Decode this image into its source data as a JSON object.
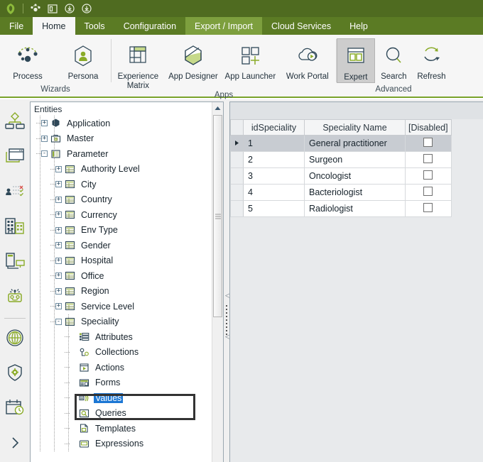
{
  "titlebar": {
    "icons": [
      {
        "name": "app-logo-icon",
        "label": "Bizagi"
      },
      {
        "name": "process-quick-icon",
        "label": "Process"
      },
      {
        "name": "layout-quick-icon",
        "label": "Layout"
      },
      {
        "name": "download-quick-icon",
        "label": "Download"
      },
      {
        "name": "download-alt-quick-icon",
        "label": "Download Alt"
      }
    ]
  },
  "tabs": [
    {
      "id": "file",
      "label": "File",
      "state": "normal"
    },
    {
      "id": "home",
      "label": "Home",
      "state": "active"
    },
    {
      "id": "tools",
      "label": "Tools",
      "state": "normal"
    },
    {
      "id": "configuration",
      "label": "Configuration",
      "state": "normal"
    },
    {
      "id": "export-import",
      "label": "Export / Import",
      "state": "hover"
    },
    {
      "id": "cloud-services",
      "label": "Cloud Services",
      "state": "normal"
    },
    {
      "id": "help",
      "label": "Help",
      "state": "normal"
    }
  ],
  "ribbon": {
    "groups": [
      {
        "id": "wizards",
        "title": "Wizards",
        "buttons": [
          {
            "id": "process",
            "label": "Process",
            "icon": "process-network-icon",
            "selected": false
          },
          {
            "id": "persona",
            "label": "Persona",
            "icon": "persona-hexagon-icon",
            "selected": false
          }
        ]
      },
      {
        "id": "apps",
        "title": "Apps",
        "buttons": [
          {
            "id": "experience-matrix",
            "label": "Experience Matrix",
            "icon": "matrix-grid-icon",
            "selected": false
          },
          {
            "id": "app-designer",
            "label": "App Designer",
            "icon": "hexagon-designer-icon",
            "selected": false
          },
          {
            "id": "app-launcher",
            "label": "App Launcher",
            "icon": "squares-plus-icon",
            "selected": false
          },
          {
            "id": "work-portal",
            "label": "Work Portal",
            "icon": "cloud-play-icon",
            "selected": false
          }
        ]
      },
      {
        "id": "advanced",
        "title": "Advanced",
        "buttons": [
          {
            "id": "expert",
            "label": "Expert",
            "icon": "expert-window-icon",
            "selected": true
          },
          {
            "id": "search",
            "label": "Search",
            "icon": "search-magnifier-icon",
            "selected": false
          },
          {
            "id": "refresh",
            "label": "Refresh",
            "icon": "refresh-arrows-icon",
            "selected": false
          }
        ]
      }
    ]
  },
  "rail": {
    "items": [
      {
        "id": "process-model",
        "icon": "org-hierarchy-icon"
      },
      {
        "id": "forms",
        "icon": "browser-window-icon"
      },
      {
        "id": "business-rules",
        "icon": "user-rules-icon"
      },
      {
        "id": "organization",
        "icon": "buildings-icon"
      },
      {
        "id": "integration",
        "icon": "server-monitor-icon"
      },
      {
        "id": "bots",
        "icon": "robot-icon"
      },
      {
        "id": "separator",
        "icon": "divider"
      },
      {
        "id": "globalization",
        "icon": "globe-icon"
      },
      {
        "id": "security",
        "icon": "shield-gear-icon"
      },
      {
        "id": "scheduler",
        "icon": "calendar-clock-icon"
      },
      {
        "id": "expand",
        "icon": "chevron-right-icon"
      }
    ]
  },
  "tree": {
    "header": "Entities",
    "nodes": [
      {
        "label": "Application",
        "depth": 0,
        "expander": "+",
        "icon": "entity-application-icon",
        "selected": false
      },
      {
        "label": "Master",
        "depth": 0,
        "expander": "+",
        "icon": "entity-master-icon",
        "selected": false
      },
      {
        "label": "Parameter",
        "depth": 0,
        "expander": "-",
        "icon": "entity-parameter-icon",
        "selected": false
      },
      {
        "label": "Authority Level",
        "depth": 1,
        "expander": "+",
        "icon": "entity-table-icon",
        "selected": false
      },
      {
        "label": "City",
        "depth": 1,
        "expander": "+",
        "icon": "entity-table-icon",
        "selected": false
      },
      {
        "label": "Country",
        "depth": 1,
        "expander": "+",
        "icon": "entity-table-icon",
        "selected": false
      },
      {
        "label": "Currency",
        "depth": 1,
        "expander": "+",
        "icon": "entity-table-icon",
        "selected": false
      },
      {
        "label": "Env Type",
        "depth": 1,
        "expander": "+",
        "icon": "entity-table-icon",
        "selected": false
      },
      {
        "label": "Gender",
        "depth": 1,
        "expander": "+",
        "icon": "entity-table-icon",
        "selected": false
      },
      {
        "label": "Hospital",
        "depth": 1,
        "expander": "+",
        "icon": "entity-table-icon",
        "selected": false
      },
      {
        "label": "Office",
        "depth": 1,
        "expander": "+",
        "icon": "entity-table-icon",
        "selected": false
      },
      {
        "label": "Region",
        "depth": 1,
        "expander": "+",
        "icon": "entity-table-icon",
        "selected": false
      },
      {
        "label": "Service Level",
        "depth": 1,
        "expander": "+",
        "icon": "entity-table-icon",
        "selected": false
      },
      {
        "label": "Speciality",
        "depth": 1,
        "expander": "-",
        "icon": "entity-table-icon",
        "selected": false
      },
      {
        "label": "Attributes",
        "depth": 2,
        "expander": "",
        "icon": "attributes-icon",
        "selected": false
      },
      {
        "label": "Collections",
        "depth": 2,
        "expander": "",
        "icon": "collections-icon",
        "selected": false
      },
      {
        "label": "Actions",
        "depth": 2,
        "expander": "",
        "icon": "actions-icon",
        "selected": false
      },
      {
        "label": "Forms",
        "depth": 2,
        "expander": "",
        "icon": "forms-icon",
        "selected": false
      },
      {
        "label": "Values",
        "depth": 2,
        "expander": "",
        "icon": "values-icon",
        "selected": true
      },
      {
        "label": "Queries",
        "depth": 2,
        "expander": "",
        "icon": "queries-icon",
        "selected": false
      },
      {
        "label": "Templates",
        "depth": 2,
        "expander": "",
        "icon": "templates-icon",
        "selected": false
      },
      {
        "label": "Expressions",
        "depth": 2,
        "expander": "",
        "icon": "expressions-icon",
        "selected": false
      }
    ]
  },
  "grid": {
    "columns": [
      "idSpeciality",
      "Speciality Name",
      "[Disabled]"
    ],
    "rows": [
      {
        "id": "1",
        "name": "General practitioner",
        "disabled": false,
        "selected": true
      },
      {
        "id": "2",
        "name": "Surgeon",
        "disabled": false,
        "selected": false
      },
      {
        "id": "3",
        "name": "Oncologist",
        "disabled": false,
        "selected": false
      },
      {
        "id": "4",
        "name": "Bacteriologist",
        "disabled": false,
        "selected": false
      },
      {
        "id": "5",
        "name": "Radiologist",
        "disabled": false,
        "selected": false
      }
    ]
  },
  "colors": {
    "title_bar": "#4f6b20",
    "tab_strip": "#5b7b24",
    "tab_hover": "#7d9f3e",
    "accent_green": "#8aab28",
    "ribbon_bg": "#f6f6f6",
    "dark_blue": "#2f4858",
    "selection_blue": "#1c77d4",
    "row_selected": "#c8ccd2"
  }
}
